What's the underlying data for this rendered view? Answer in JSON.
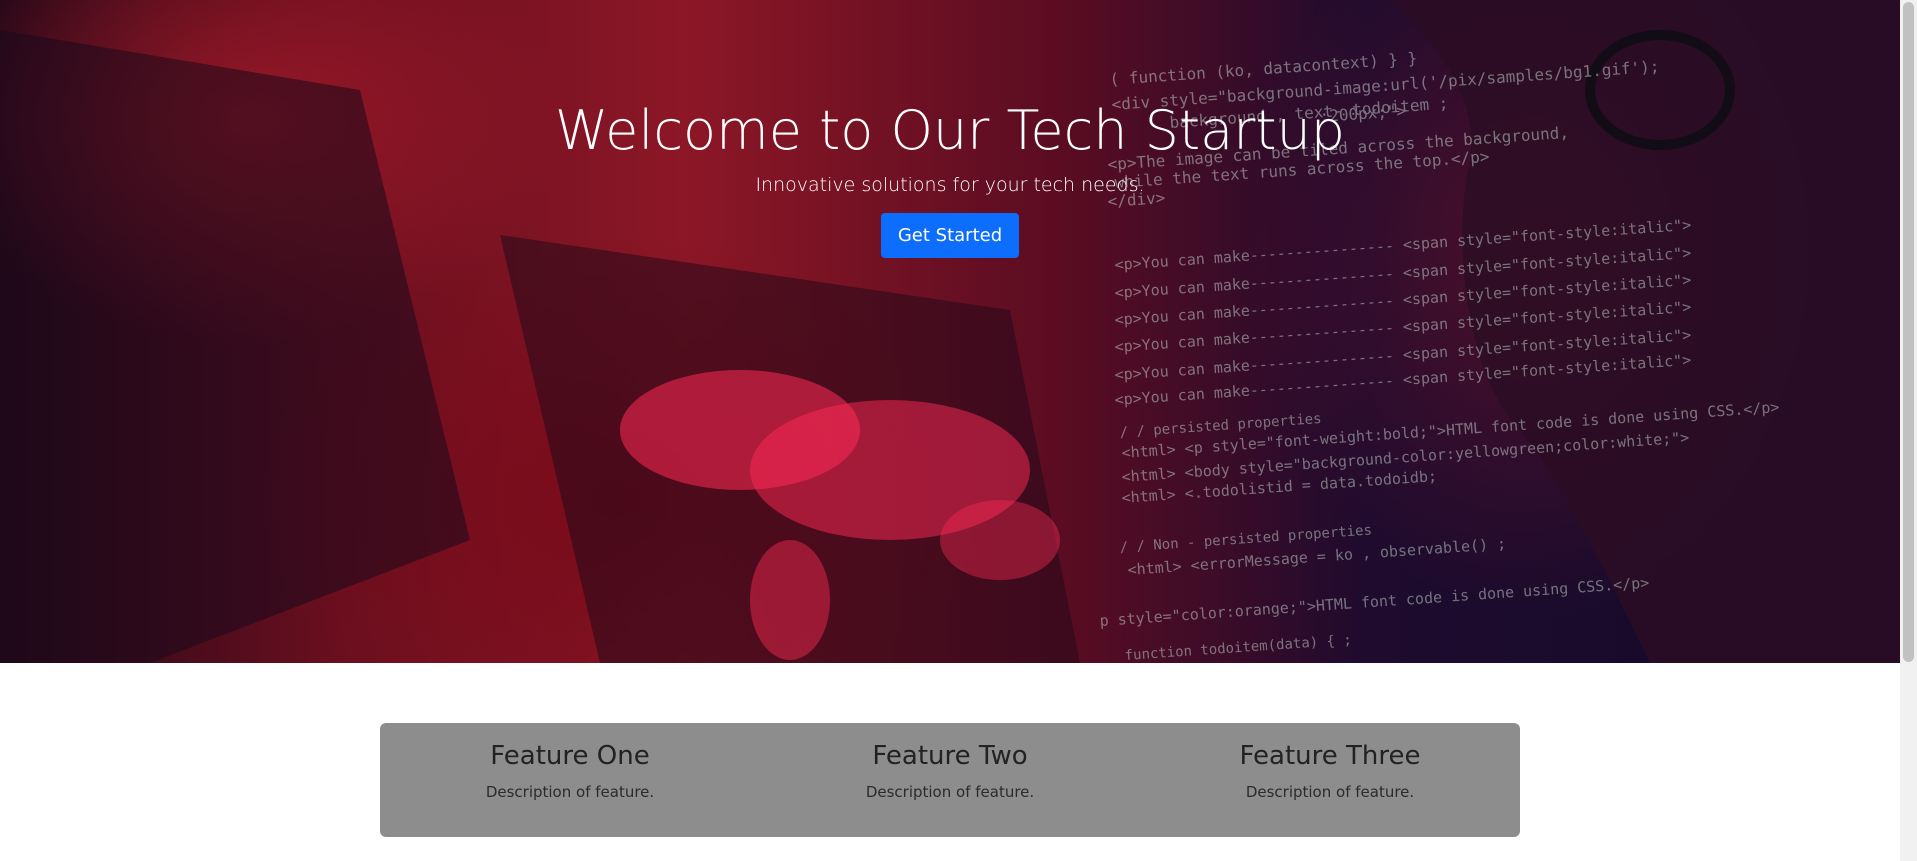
{
  "hero": {
    "title": "Welcome to Our Tech Startup",
    "subtitle": "Innovative solutions for your tech needs.",
    "cta_label": "Get Started",
    "code_overlay": [
      "( function  (ko, datacontext)  } }",
      "<div style=\"background-image:url('/pix/samples/bg1.gif');",
      "background , text- todoitem ;",
      ":200px;\">",
      "<p>The image can be tiled across the background,",
      "while the text runs across the top.</p>",
      "</div>",
      "<p>You can make---------------- <span style=\"font-style:italic\">",
      "<p>You can make---------------- <span style=\"font-style:italic\">",
      "<p>You can make---------------- <span style=\"font-style:italic\">",
      "<p>You can make---------------- <span style=\"font-style:italic\">",
      "<p>You can make---------------- <span style=\"font-style:italic\">",
      "<p>You can make---------------- <span style=\"font-style:italic\">",
      "/ /  persisted properties",
      "<html> <p style=\"font-weight:bold;\">HTML font code is done using CSS.</p>",
      "<html> <body style=\"background-color:yellowgreen;color:white;\">",
      "<html> <.todolistid = data.todoidb;",
      "/ / Non - persisted properties",
      "<html> <errorMessage = ko , observable() ;",
      "p style=\"color:orange;\">HTML font code is done using CSS.</p>",
      "function  todoitem(data) { ;"
    ]
  },
  "features": [
    {
      "title": "Feature One",
      "description": "Description of feature."
    },
    {
      "title": "Feature Two",
      "description": "Description of feature."
    },
    {
      "title": "Feature Three",
      "description": "Description of feature."
    }
  ],
  "colors": {
    "cta_background": "#0d6efd",
    "features_background": "#8d8d8d",
    "hero_text": "#ffffff"
  }
}
